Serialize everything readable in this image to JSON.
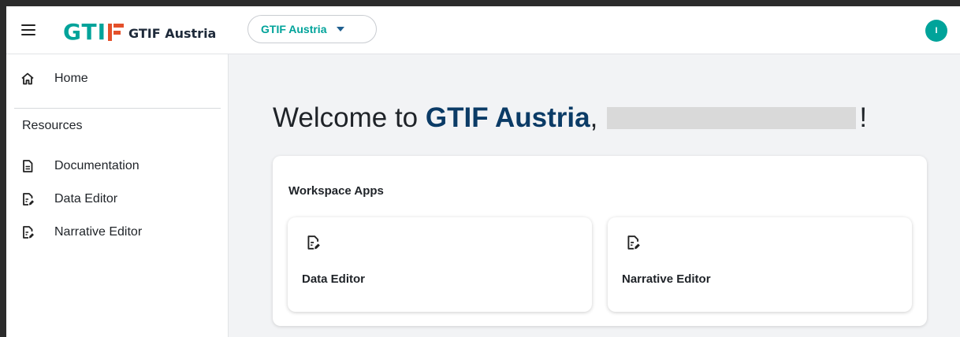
{
  "header": {
    "logo_text": "GTI",
    "logo_subtitle": "GTIF Austria",
    "selector_label": "GTIF Austria",
    "avatar_initial": "I"
  },
  "sidebar": {
    "home_label": "Home",
    "section_title": "Resources",
    "items": [
      {
        "label": "Documentation",
        "icon": "document-icon"
      },
      {
        "label": "Data Editor",
        "icon": "document-edit-icon"
      },
      {
        "label": "Narrative Editor",
        "icon": "document-edit-icon"
      }
    ]
  },
  "main": {
    "welcome_prefix": "Welcome to ",
    "welcome_brand": "GTIF Austria",
    "welcome_comma": ",",
    "welcome_suffix": "!",
    "apps_title": "Workspace Apps",
    "apps": [
      {
        "label": "Data Editor",
        "icon": "document-edit-icon"
      },
      {
        "label": "Narrative Editor",
        "icon": "document-edit-icon"
      }
    ]
  },
  "colors": {
    "accent": "#00a39a",
    "logo_f": "#e4502a",
    "brand_text": "#0b3b66",
    "background": "#f2f3f5"
  }
}
